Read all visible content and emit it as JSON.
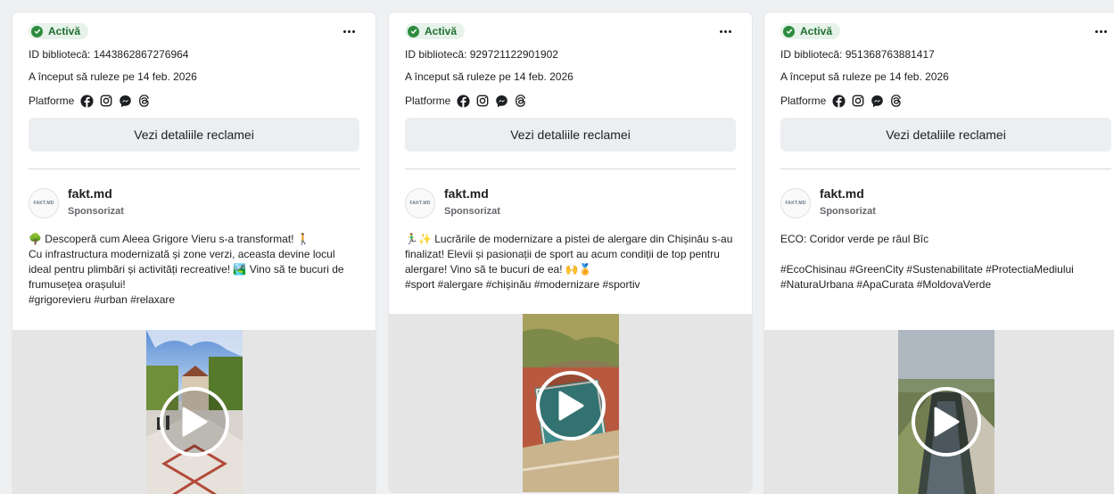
{
  "cards": [
    {
      "status": "Activă",
      "library_id": "ID bibliotecă: 1443862867276964",
      "started": "A început să ruleze pe 14 feb. 2026",
      "platforms_label": "Platforme",
      "platform_icons": [
        "facebook-icon",
        "instagram-icon",
        "messenger-icon",
        "threads-icon"
      ],
      "details_button": "Vezi detaliile reclamei",
      "advertiser": {
        "name": "fakt.md",
        "sponsored": "Sponsorizat",
        "avatar_text": "FAKT.MD"
      },
      "ad_text": "🌳 Descoperă cum Aleea Grigore Vieru s-a transformat! 🚶\nCu infrastructura modernizată și zone verzi, aceasta devine locul ideal pentru plimbări și activități recreative! 🏞️ Vino să te bucuri de frumusețea orașului!\n#grigorevieru #urban #relaxare"
    },
    {
      "status": "Activă",
      "library_id": "ID bibliotecă: 929721122901902",
      "started": "A început să ruleze pe 14 feb. 2026",
      "platforms_label": "Platforme",
      "platform_icons": [
        "facebook-icon",
        "instagram-icon",
        "messenger-icon",
        "threads-icon"
      ],
      "details_button": "Vezi detaliile reclamei",
      "advertiser": {
        "name": "fakt.md",
        "sponsored": "Sponsorizat",
        "avatar_text": "FAKT.MD"
      },
      "ad_text": "🏃‍♂️✨ Lucrările de modernizare a pistei de alergare din Chișinău s-au finalizat! Elevii și pasionații de sport au acum condiții de top pentru alergare! Vino să te bucuri de ea! 🙌🏅\n#sport #alergare #chișinău #modernizare #sportiv"
    },
    {
      "status": "Activă",
      "library_id": "ID bibliotecă: 951368763881417",
      "started": "A început să ruleze pe 14 feb. 2026",
      "platforms_label": "Platforme",
      "platform_icons": [
        "facebook-icon",
        "instagram-icon",
        "messenger-icon",
        "threads-icon"
      ],
      "details_button": "Vezi detaliile reclamei",
      "advertiser": {
        "name": "fakt.md",
        "sponsored": "Sponsorizat",
        "avatar_text": "FAKT.MD"
      },
      "ad_text": "ECO: Coridor verde pe râul Bîc\n\n#EcoChisinau #GreenCity #Sustenabilitate #ProtectiaMediului #NaturaUrbana #ApaCurata #MoldovaVerde"
    }
  ],
  "colors": {
    "active_badge_bg": "#e7f3ea",
    "active_badge_dot": "#2e8b3f",
    "button_bg": "#eceef1",
    "media_bg": "#e5e5e5"
  }
}
